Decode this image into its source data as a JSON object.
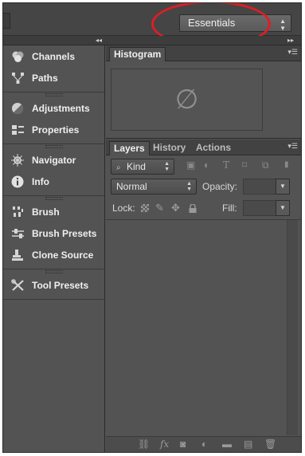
{
  "workspace": {
    "label": "Essentials"
  },
  "dock": {
    "groups": [
      {
        "items": [
          {
            "label": "Channels",
            "icon": "channels-icon"
          },
          {
            "label": "Paths",
            "icon": "paths-icon"
          }
        ]
      },
      {
        "items": [
          {
            "label": "Adjustments",
            "icon": "adjustments-icon"
          },
          {
            "label": "Properties",
            "icon": "properties-icon"
          }
        ]
      },
      {
        "items": [
          {
            "label": "Navigator",
            "icon": "navigator-icon"
          },
          {
            "label": "Info",
            "icon": "info-icon"
          }
        ]
      },
      {
        "items": [
          {
            "label": "Brush",
            "icon": "brush-icon"
          },
          {
            "label": "Brush Presets",
            "icon": "brush-presets-icon"
          },
          {
            "label": "Clone Source",
            "icon": "clone-source-icon"
          }
        ]
      },
      {
        "items": [
          {
            "label": "Tool Presets",
            "icon": "tool-presets-icon"
          }
        ]
      }
    ]
  },
  "histogram_panel": {
    "tab": "Histogram",
    "empty_symbol": "∅"
  },
  "layers_panel": {
    "tabs": [
      "Layers",
      "History",
      "Actions"
    ],
    "filter": {
      "value": "Kind"
    },
    "blend_mode": {
      "value": "Normal"
    },
    "opacity_label": "Opacity:",
    "lock_label": "Lock:",
    "fill_label": "Fill:"
  },
  "colors": {
    "accent_oval": "#e01d24",
    "panel_bg": "#535353",
    "bar_bg": "#454545"
  }
}
